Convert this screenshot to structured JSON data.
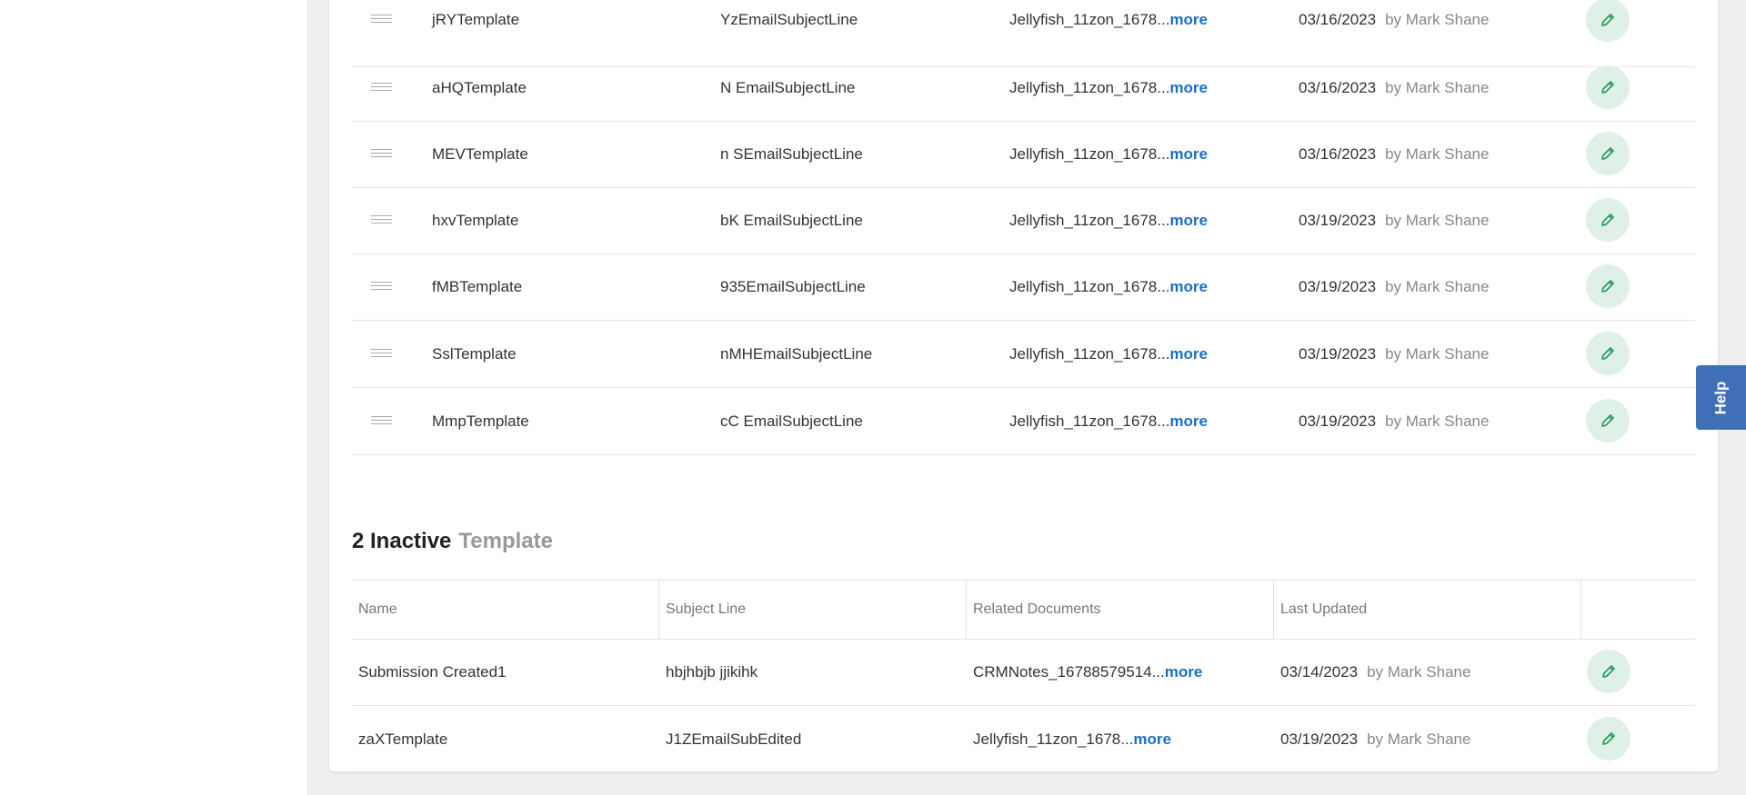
{
  "active_rows": [
    {
      "name": "jRYTemplate",
      "subject": "YzEmailSubjectLine",
      "docs": "Jellyfish_11zon_1678...",
      "more": "more",
      "date": "03/16/2023",
      "by": "by Mark Shane"
    },
    {
      "name": "aHQTemplate",
      "subject": "N EmailSubjectLine",
      "docs": "Jellyfish_11zon_1678...",
      "more": "more",
      "date": "03/16/2023",
      "by": "by Mark Shane"
    },
    {
      "name": "MEVTemplate",
      "subject": "n SEmailSubjectLine",
      "docs": "Jellyfish_11zon_1678...",
      "more": "more",
      "date": "03/16/2023",
      "by": "by Mark Shane"
    },
    {
      "name": "hxvTemplate",
      "subject": "bK EmailSubjectLine",
      "docs": "Jellyfish_11zon_1678...",
      "more": "more",
      "date": "03/19/2023",
      "by": "by Mark Shane"
    },
    {
      "name": "fMBTemplate",
      "subject": "935EmailSubjectLine",
      "docs": "Jellyfish_11zon_1678...",
      "more": "more",
      "date": "03/19/2023",
      "by": "by Mark Shane"
    },
    {
      "name": "SslTemplate",
      "subject": "nMHEmailSubjectLine",
      "docs": "Jellyfish_11zon_1678...",
      "more": "more",
      "date": "03/19/2023",
      "by": "by Mark Shane"
    },
    {
      "name": "MmpTemplate",
      "subject": "cC EmailSubjectLine",
      "docs": "Jellyfish_11zon_1678...",
      "more": "more",
      "date": "03/19/2023",
      "by": "by Mark Shane"
    }
  ],
  "inactive_section": {
    "count_label": "2 Inactive",
    "sub_label": "Template",
    "headers": {
      "name": "Name",
      "subject": "Subject Line",
      "docs": "Related Documents",
      "updated": "Last Updated"
    },
    "rows": [
      {
        "name": "Submission Created1",
        "subject": "hbjhbjb jjikihk",
        "docs": "CRMNotes_16788579514...",
        "more": "more",
        "date": "03/14/2023",
        "by": "by Mark Shane"
      },
      {
        "name": "zaXTemplate",
        "subject": "J1ZEmailSubEdited",
        "docs": "Jellyfish_11zon_1678...",
        "more": "more",
        "date": "03/19/2023",
        "by": "by Mark Shane"
      }
    ]
  },
  "help_label": "Help",
  "icons": {
    "edit": "pencil-icon",
    "drag": "drag-handle-icon"
  },
  "colors": {
    "link": "#1a6fc4",
    "edit_bg": "#dff1e6",
    "edit_icon": "#2e9e63",
    "help_bg": "#3f6fb6"
  }
}
